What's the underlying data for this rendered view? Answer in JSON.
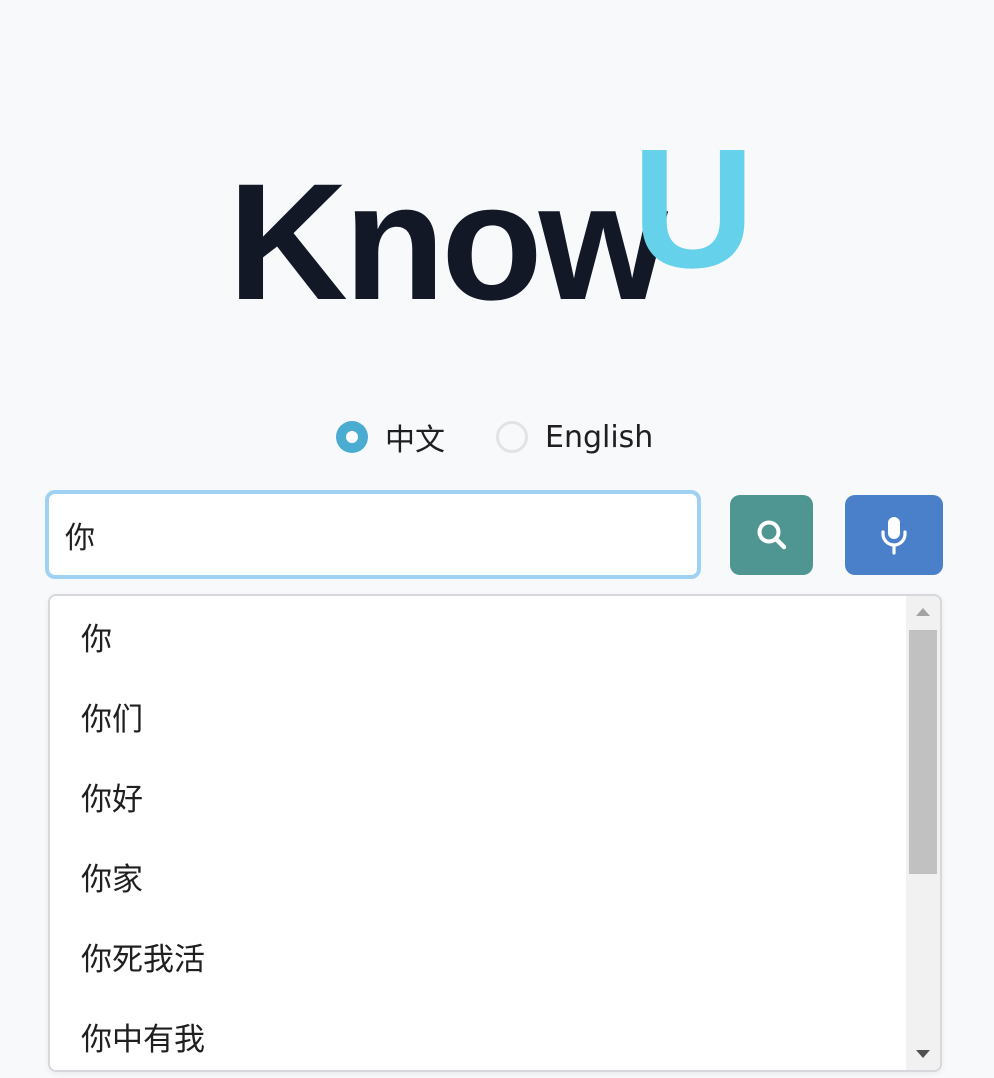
{
  "logo": {
    "part1": "Know",
    "part2": "U",
    "colors": {
      "part1": "#121826",
      "part2": "#66d1ea"
    }
  },
  "language": {
    "options": [
      {
        "label": "中文",
        "selected": true
      },
      {
        "label": "English",
        "selected": false
      }
    ]
  },
  "search": {
    "value": "你",
    "search_icon": "search-icon",
    "mic_icon": "microphone-icon",
    "colors": {
      "search_button": "#4f9592",
      "mic_button": "#4a80c9",
      "focus_border": "#9fd2f2"
    }
  },
  "suggestions": {
    "items": [
      "你",
      "你们",
      "你好",
      "你家",
      "你死我活",
      "你中有我"
    ],
    "scroll_fraction": 0.0
  }
}
